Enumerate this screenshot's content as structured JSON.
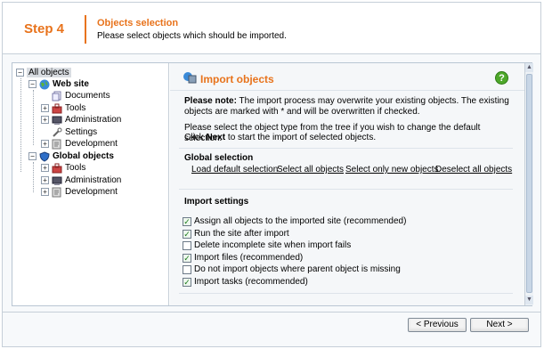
{
  "header": {
    "step": "Step 4",
    "title": "Objects selection",
    "subtitle": "Please select objects which should be imported."
  },
  "tree": {
    "root": "All objects",
    "website": {
      "label": "Web site",
      "children": [
        "Documents",
        "Tools",
        "Administration",
        "Settings",
        "Development"
      ]
    },
    "global": {
      "label": "Global objects",
      "children": [
        "Tools",
        "Administration",
        "Development"
      ]
    }
  },
  "panel": {
    "title": "Import objects",
    "note_label": "Please note:",
    "note_text": " The import process may overwrite your existing objects. The existing objects are marked with * and will be overwritten if checked.",
    "instr1": "Please select the object type from the tree if you wish to change the default selection.",
    "instr2_pre": "Click ",
    "instr2_bold": "Next",
    "instr2_post": " to start the import of selected objects.",
    "global_selection_heading": "Global selection",
    "global_links": [
      "Load default selection",
      "Select all objects",
      "Select only new objects",
      "Deselect all objects"
    ],
    "import_settings_heading": "Import settings",
    "settings": [
      {
        "label": "Assign all objects to the imported site (recommended)",
        "checked": true
      },
      {
        "label": "Run the site after import",
        "checked": true
      },
      {
        "label": "Delete incomplete site when import fails",
        "checked": false
      },
      {
        "label": "Import files (recommended)",
        "checked": true
      },
      {
        "label": "Do not import objects where parent object is missing",
        "checked": false
      },
      {
        "label": "Import tasks (recommended)",
        "checked": true
      }
    ],
    "help_icon": "?"
  },
  "footer": {
    "previous_label": "< Previous",
    "next_label": "Next >"
  },
  "colors": {
    "accent": "#e8731c",
    "border": "#c6cfd8",
    "check": "#1a7a1a"
  }
}
